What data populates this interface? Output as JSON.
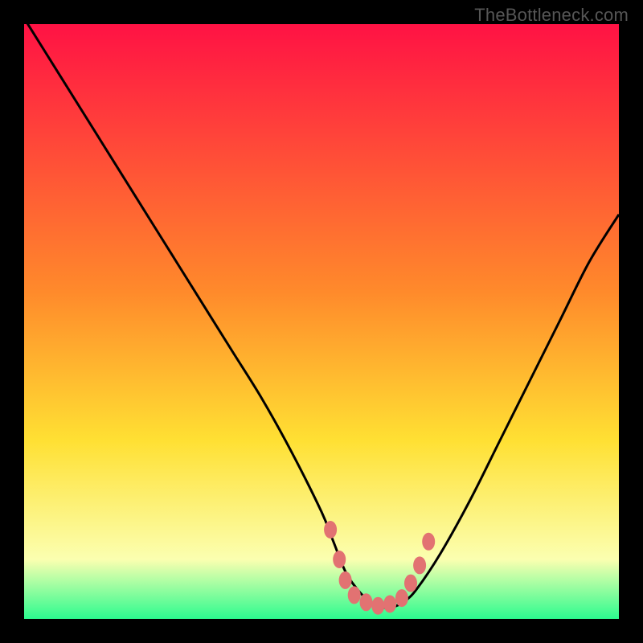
{
  "header": {
    "watermark": "TheBottleneck.com"
  },
  "colors": {
    "frame": "#000000",
    "watermark": "#565656",
    "gradient_top": "#ff1244",
    "gradient_mid_upper": "#ff8a2b",
    "gradient_mid": "#ffe033",
    "gradient_lower": "#fbffb0",
    "gradient_bottom": "#2cfb8f",
    "curve": "#000000",
    "marker": "#e27272"
  },
  "chart_data": {
    "type": "line",
    "title": "",
    "xlabel": "",
    "ylabel": "",
    "xlim": [
      0,
      100
    ],
    "ylim": [
      0,
      100
    ],
    "grid": false,
    "series": [
      {
        "name": "bottleneck-curve",
        "x": [
          0,
          5,
          10,
          15,
          20,
          25,
          30,
          35,
          40,
          45,
          50,
          52,
          54,
          56,
          58,
          60,
          62,
          64,
          66,
          70,
          75,
          80,
          85,
          90,
          95,
          100
        ],
        "y": [
          101,
          93,
          85,
          77,
          69,
          61,
          53,
          45,
          37,
          28,
          18,
          13,
          8,
          5,
          3,
          2,
          2,
          3,
          5,
          11,
          20,
          30,
          40,
          50,
          60,
          68
        ]
      }
    ],
    "markers": [
      {
        "x": 51.5,
        "y": 15
      },
      {
        "x": 53.0,
        "y": 10
      },
      {
        "x": 54.0,
        "y": 6.5
      },
      {
        "x": 55.5,
        "y": 4
      },
      {
        "x": 57.5,
        "y": 2.8
      },
      {
        "x": 59.5,
        "y": 2.2
      },
      {
        "x": 61.5,
        "y": 2.5
      },
      {
        "x": 63.5,
        "y": 3.5
      },
      {
        "x": 65.0,
        "y": 6
      },
      {
        "x": 66.5,
        "y": 9
      },
      {
        "x": 68.0,
        "y": 13
      }
    ],
    "annotations": []
  }
}
